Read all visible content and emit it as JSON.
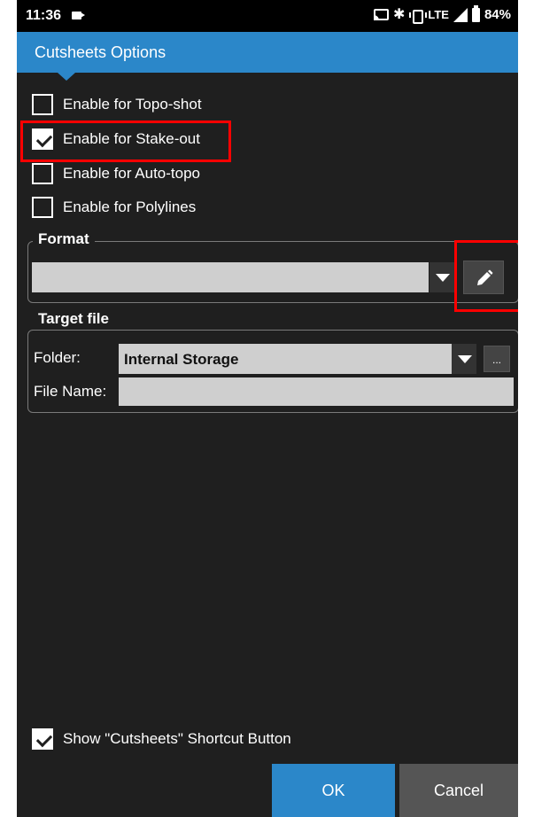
{
  "statusbar": {
    "time": "11:36",
    "network": "LTE",
    "battery": "84%"
  },
  "header": {
    "title": "Cutsheets Options"
  },
  "options": {
    "topo_shot": {
      "label": "Enable for Topo-shot",
      "checked": false
    },
    "stake_out": {
      "label": "Enable for Stake-out",
      "checked": true
    },
    "auto_topo": {
      "label": "Enable for Auto-topo",
      "checked": false
    },
    "polylines": {
      "label": "Enable for Polylines",
      "checked": false
    }
  },
  "format": {
    "legend": "Format",
    "selected": ""
  },
  "target": {
    "legend": "Target file",
    "folder_label": "Folder:",
    "folder_value": "Internal Storage",
    "browse_label": "...",
    "filename_label": "File Name:",
    "filename_value": ""
  },
  "shortcut": {
    "label": "Show \"Cutsheets\" Shortcut Button",
    "checked": true
  },
  "buttons": {
    "ok": "OK",
    "cancel": "Cancel"
  },
  "colors": {
    "accent": "#2b87c9",
    "background": "#1f1f1f",
    "highlight": "#ff0000"
  }
}
